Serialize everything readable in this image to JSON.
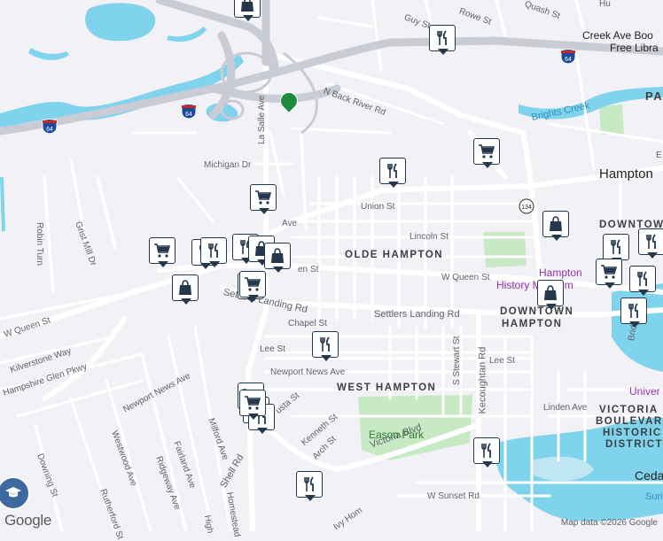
{
  "map": {
    "attribution": "Map data ©2026 Google",
    "logo": "Google",
    "colors": {
      "background": "#f2f1f5",
      "road": "#ffffff",
      "highway": "#c9ccd4",
      "water": "#7fd3ec",
      "park": "#c7e9c4",
      "marker_border": "#24374d"
    },
    "street_labels": {
      "la_salle": "La Salle Ave",
      "michigan": "Michigan Dr",
      "n_back_river": "N Back River Rd",
      "union": "Union St",
      "lincoln": "Lincoln St",
      "w_queen_e": "W Queen St",
      "w_queen_w": "W Queen St",
      "queen_partial": "en St",
      "settlers_w": "Settlers Landing Rd",
      "settlers_e": "Settlers Landing Rd",
      "chapel": "Chapel St",
      "lee_w": "Lee St",
      "lee_e": "Lee St",
      "newport_news_e": "Newport News Ave",
      "newport_news_w": "Newport News Ave",
      "linden": "Linden Ave",
      "victoria": "Victoria Blvd",
      "kecoughtan": "Kecoughtan Rd",
      "s_stewart": "S Stewart St",
      "kenneth": "Kenneth St",
      "arch": "Arch St",
      "augusta": "usta St",
      "shell": "Shell Rd",
      "milford": "Milford Ave",
      "fairland": "Fairland Ave",
      "ridgeway": "Ridgeway Ave",
      "westwood": "Westwood Ave",
      "downing": "Downing St",
      "rutherford": "Rutherford St",
      "homestead": "Homestead",
      "high": "High",
      "kilverstone": "Kilverstone Way",
      "hampshire": "Hampshire Glen Pkwy",
      "grist_mill": "Grist Mill Dr",
      "robin": "Robin Turn",
      "guy": "Guy St",
      "rowe": "Rowe St",
      "quash": "Quash St",
      "w_sunset": "W Sunset Rd",
      "ivy": "Ivy Hom",
      "bridge": "Bridge",
      "ave_partial": "Ave",
      "hu": "Hu",
      "el": "E"
    },
    "area_labels": {
      "olde_hampton": "OLDE HAMPTON",
      "west_hampton": "WEST HAMPTON",
      "downtown_1": "DOWNTOWN",
      "downtown_2": "HAMPTON",
      "downtown_top": "DOWNTOW",
      "victoria_1": "VICTORIA",
      "victoria_2": "BOULEVARD",
      "victoria_3": "HISTORIC",
      "victoria_4": "DISTRICT",
      "pa": "PA"
    },
    "place_labels": {
      "hampton": "Hampton",
      "eason_park": "Eason Park",
      "brights_creek": "Brights Creek",
      "library_1": "Creek Ave Boo",
      "library_2": "Free Libra",
      "history_1": "Hampton",
      "history_2": "History Museum",
      "univer": "Univer",
      "ceda": "Ceda",
      "sun": "Sun"
    },
    "shields": [
      {
        "label": "64",
        "type": "interstate"
      },
      {
        "label": "64",
        "type": "interstate"
      },
      {
        "label": "64",
        "type": "interstate"
      },
      {
        "label": "134",
        "type": "state"
      }
    ],
    "markers": [
      {
        "icon": "bag"
      },
      {
        "icon": "utensils"
      },
      {
        "icon": "cart"
      },
      {
        "icon": "utensils"
      },
      {
        "icon": "cart"
      },
      {
        "icon": "cart"
      },
      {
        "icon": "utensils"
      },
      {
        "icon": "utensils"
      },
      {
        "icon": "utensils"
      },
      {
        "icon": "bag"
      },
      {
        "icon": "bag"
      },
      {
        "icon": "bag"
      },
      {
        "icon": "bag"
      },
      {
        "icon": "utensils"
      },
      {
        "icon": "cart"
      },
      {
        "icon": "bag"
      },
      {
        "icon": "utensils"
      },
      {
        "icon": "utensils"
      },
      {
        "icon": "cart"
      },
      {
        "icon": "bag"
      },
      {
        "icon": "utensils"
      },
      {
        "icon": "cart"
      },
      {
        "icon": "utensils"
      },
      {
        "icon": "utensils"
      },
      {
        "icon": "cart"
      },
      {
        "icon": "utensils"
      },
      {
        "icon": "utensils"
      },
      {
        "icon": "utensils"
      }
    ]
  }
}
